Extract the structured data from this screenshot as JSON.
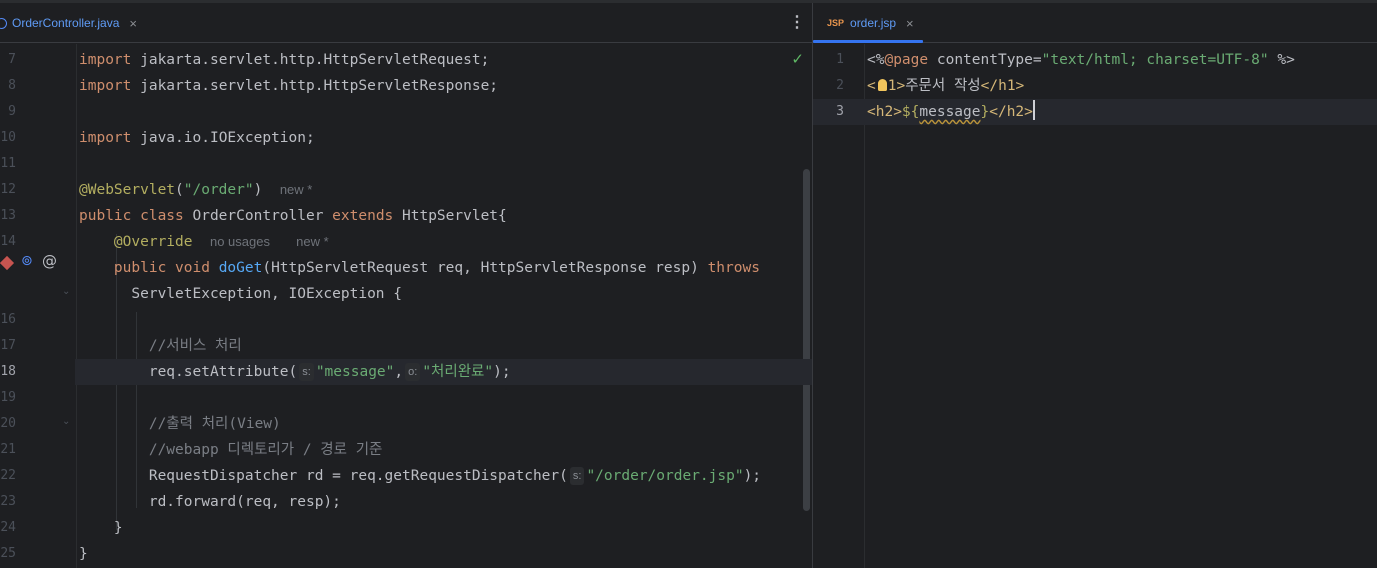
{
  "left_tab": {
    "label": "OrderController.java",
    "close": "×"
  },
  "right_tab": {
    "label": "order.jsp",
    "icon_text": "JSP",
    "close": "×"
  },
  "menu_glyph": "⋮",
  "java_lines": [
    {
      "num": "7",
      "html": "<span class='kw'>import</span> jakarta.servlet.http.HttpServletRequest;"
    },
    {
      "num": "8",
      "html": "<span class='kw'>import</span> jakarta.servlet.http.HttpServletResponse;"
    },
    {
      "num": "9",
      "html": ""
    },
    {
      "num": "10",
      "html": "<span class='kw'>import</span> java.io.IOException;"
    },
    {
      "num": "11",
      "html": ""
    },
    {
      "num": "12",
      "html": "<span class='ann'>@WebServlet</span>(<span class='str'>\"/order\"</span>)  <span class='hint'>new *</span>"
    },
    {
      "num": "13",
      "html": "<span class='kw'>public class</span> OrderController <span class='kw'>extends</span> HttpServlet{"
    },
    {
      "num": "14",
      "html": "    <span class='ann'>@Override</span>  <span class='hint'>no usages</span>   <span class='hint'>new *</span>"
    },
    {
      "num": "",
      "html": "    <span class='kw'>public void</span> <span class='fn'>doGet</span>(HttpServletRequest req, HttpServletResponse resp) <span class='kw'>throws</span>"
    },
    {
      "num": "",
      "html": "      ServletException, IOException {"
    },
    {
      "num": "16",
      "html": ""
    },
    {
      "num": "17",
      "html": "        <span class='cmt'>//서비스 처리</span>"
    },
    {
      "num": "18",
      "html": "        req.setAttribute(<span class='phint'>s:</span><span class='str'>\"message\"</span>,<span class='phint'>o:</span><span class='str'>\"처리완료\"</span>);"
    },
    {
      "num": "19",
      "html": ""
    },
    {
      "num": "20",
      "html": "        <span class='cmt'>//출력 처리(View)</span>"
    },
    {
      "num": "21",
      "html": "        <span class='cmt'>//webapp 디렉토리가 / 경로 기준</span>"
    },
    {
      "num": "22",
      "html": "        RequestDispatcher rd = req.getRequestDispatcher(<span class='phint'>s:</span><span class='str'>\"/order/order.jsp\"</span>);"
    },
    {
      "num": "23",
      "html": "        rd.forward(req, resp);"
    },
    {
      "num": "24",
      "html": "    }"
    },
    {
      "num": "25",
      "html": "}"
    }
  ],
  "jsp_lines": [
    {
      "num": "1",
      "html": "<span class='plain'>&lt;%</span><span class='kw'>@page</span> contentType=<span class='str'>\"text/html; charset=UTF-8\"</span> %&gt;"
    },
    {
      "num": "2",
      "html": "<span class='tag'>&lt;</span><span class='bulb'></span><span class='tag'>1&gt;</span>주문서 작성<span class='tag'>&lt;/h1&gt;</span>"
    },
    {
      "num": "3",
      "html": "<span class='tag'>&lt;h2&gt;</span><span class='ann'>${</span><span class='squig'>message</span><span class='ann'>}</span><span class='tag'>&lt;/h2&gt;</span><span class='caret'></span>"
    }
  ],
  "colors": {
    "accent": "#3574f0",
    "background": "#1e1f22"
  }
}
